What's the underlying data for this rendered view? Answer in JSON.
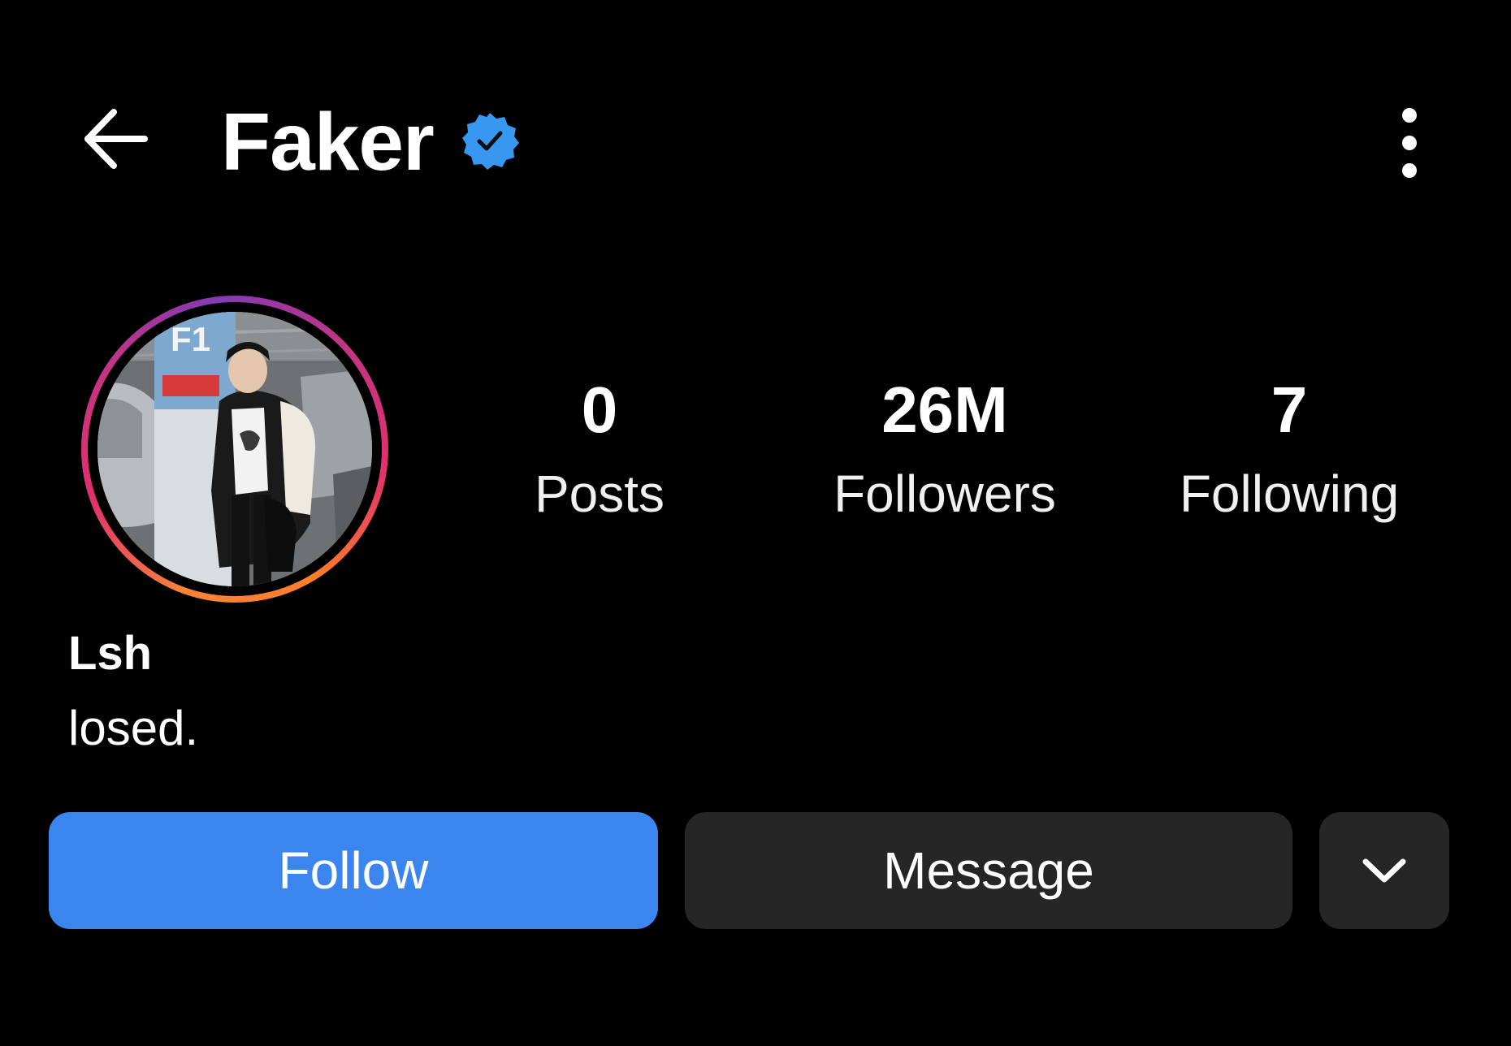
{
  "header": {
    "back_icon": "arrow-left-icon",
    "title": "Faker",
    "verified_icon": "verified-badge-icon",
    "verified_color": "#3897f0",
    "more_icon": "vertical-dots-icon"
  },
  "profile": {
    "avatar_ring_colors": [
      "#833ab4",
      "#c13584",
      "#e1306c",
      "#fd7e2a"
    ],
    "avatar_sign_text": "F1",
    "stats": [
      {
        "value": "0",
        "label": "Posts"
      },
      {
        "value": "26M",
        "label": "Followers"
      },
      {
        "value": "7",
        "label": "Following"
      }
    ],
    "name": "Lsh",
    "bio": "losed."
  },
  "actions": {
    "follow_label": "Follow",
    "follow_color": "#3a86ee",
    "message_label": "Message",
    "more_icon": "chevron-down-icon",
    "secondary_color": "#262626"
  }
}
